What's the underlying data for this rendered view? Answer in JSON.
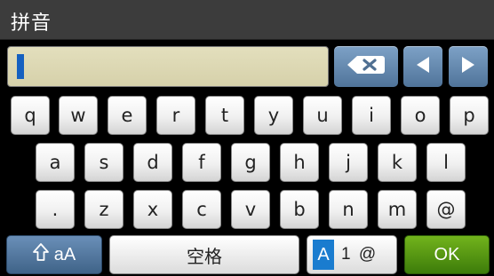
{
  "header": {
    "title": "拼音"
  },
  "input": {
    "value": ""
  },
  "controls": {
    "backspace": "backspace-icon",
    "left": "left-arrow-icon",
    "right": "right-arrow-icon"
  },
  "keyboard": {
    "row1": [
      "q",
      "w",
      "e",
      "r",
      "t",
      "y",
      "u",
      "i",
      "o",
      "p"
    ],
    "row2": [
      "a",
      "s",
      "d",
      "f",
      "g",
      "h",
      "j",
      "k",
      "l"
    ],
    "row3": [
      ".",
      "z",
      "x",
      "c",
      "v",
      "b",
      "n",
      "m",
      "@"
    ]
  },
  "bottom": {
    "shift_label": "aA",
    "space_label": "空格",
    "mode_active": "A",
    "mode_rest": "1 @",
    "ok_label": "OK"
  },
  "colors": {
    "control_blue": "#6a8fb8",
    "ok_green": "#5da214",
    "input_bg": "#ddd8b4",
    "caret": "#1560c0"
  }
}
